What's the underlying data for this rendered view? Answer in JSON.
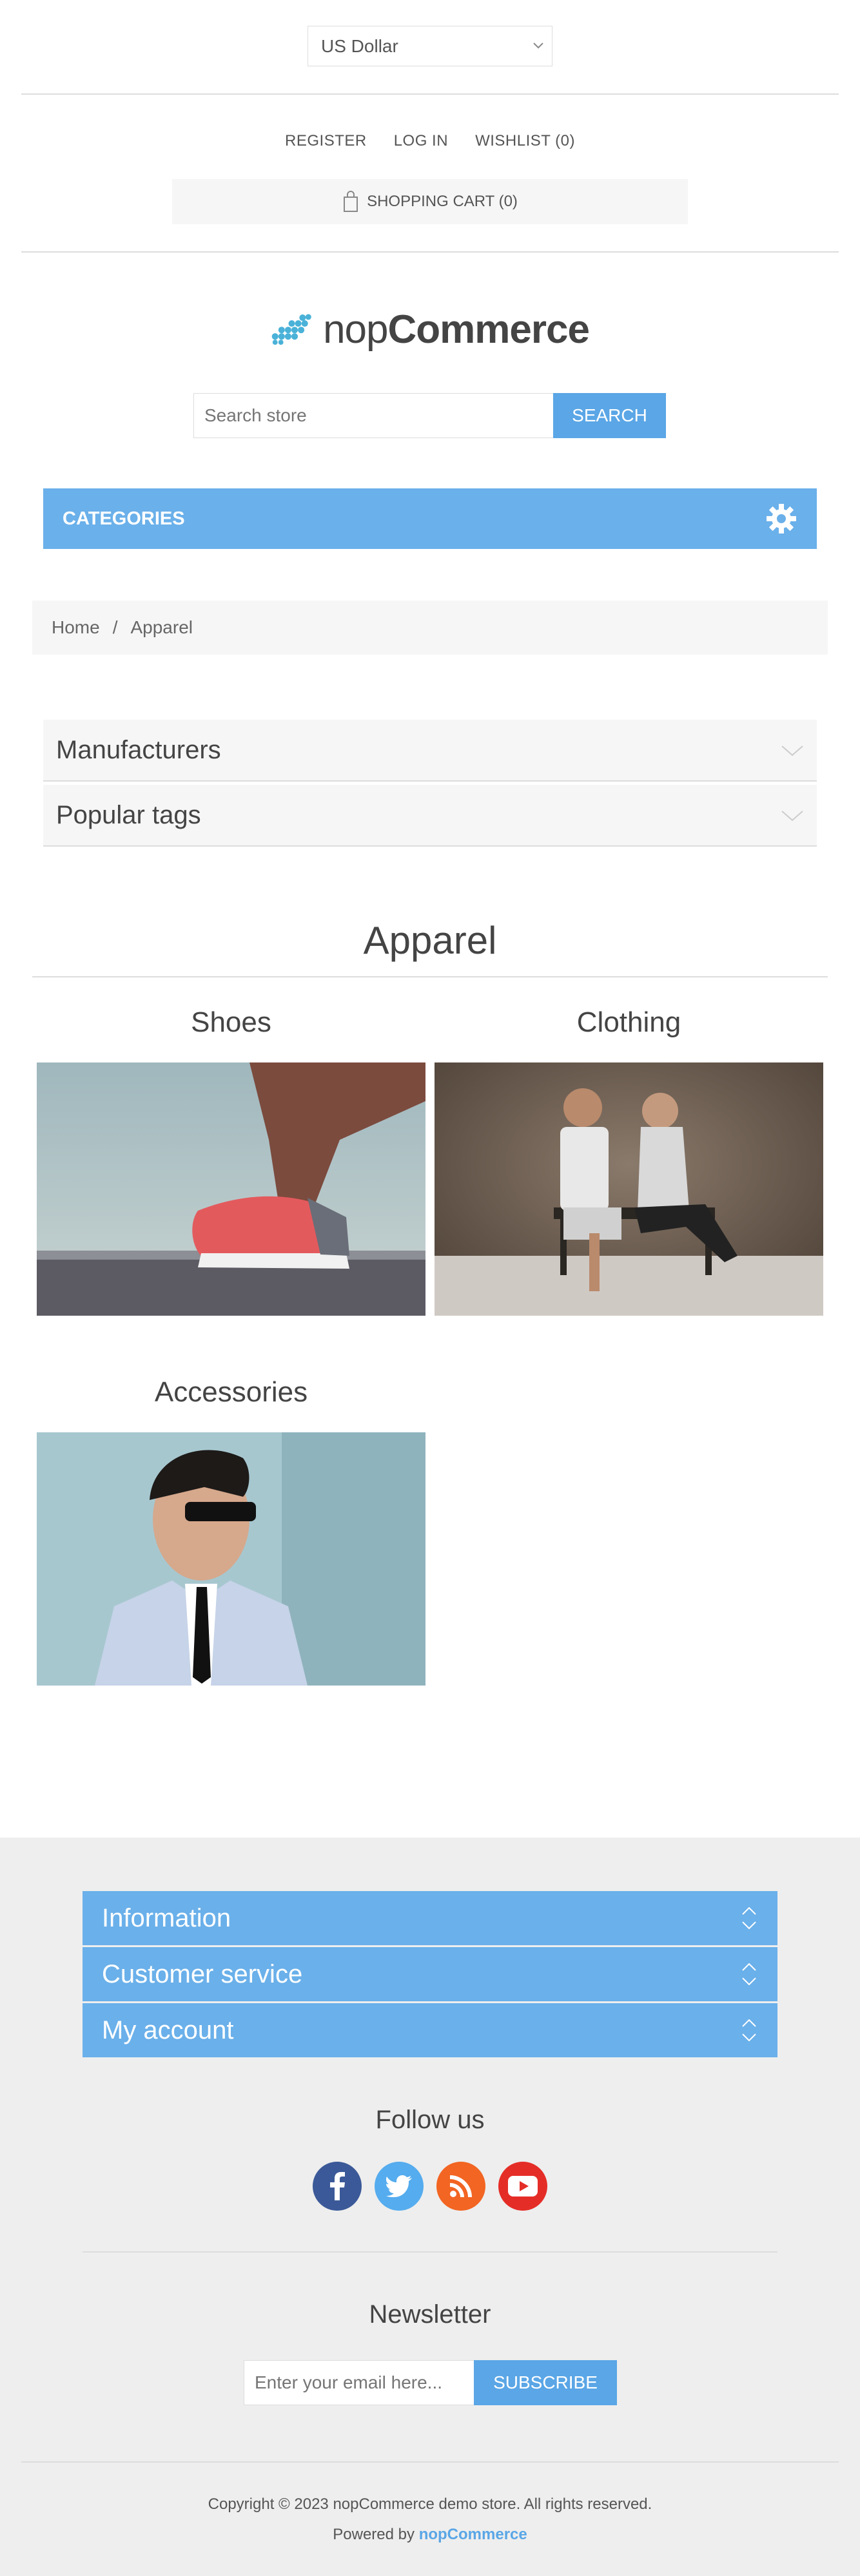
{
  "header": {
    "currency": "US Dollar",
    "links": {
      "register": "REGISTER",
      "login": "LOG IN",
      "wishlist": "WISHLIST (0)"
    },
    "cart": "SHOPPING CART (0)"
  },
  "logo": {
    "text_light": "nop",
    "text_bold": "Commerce",
    "brand_color": "#4ab2d8"
  },
  "search": {
    "placeholder": "Search store",
    "button": "SEARCH"
  },
  "categories_bar": {
    "label": "CATEGORIES",
    "icon": "gear-icon",
    "color": "#6ab0ea"
  },
  "breadcrumb": {
    "home": "Home",
    "separator": "/",
    "current": "Apparel"
  },
  "side_blocks": [
    {
      "label": "Manufacturers"
    },
    {
      "label": "Popular tags"
    }
  ],
  "page": {
    "title": "Apparel"
  },
  "subcategories": [
    {
      "name": "Shoes"
    },
    {
      "name": "Clothing"
    },
    {
      "name": "Accessories"
    }
  ],
  "footer": {
    "sections": [
      {
        "label": "Information"
      },
      {
        "label": "Customer service"
      },
      {
        "label": "My account"
      }
    ],
    "follow_us": "Follow us",
    "social": [
      {
        "icon": "facebook-icon",
        "color": "#3b5998"
      },
      {
        "icon": "twitter-icon",
        "color": "#55acee"
      },
      {
        "icon": "rss-icon",
        "color": "#f26522"
      },
      {
        "icon": "youtube-icon",
        "color": "#e52d27"
      }
    ],
    "newsletter": {
      "title": "Newsletter",
      "placeholder": "Enter your email here...",
      "button": "SUBSCRIBE"
    },
    "copyright": "Copyright © 2023 nopCommerce demo store. All rights reserved.",
    "powered_prefix": "Powered by",
    "powered_brand": "nopCommerce"
  }
}
